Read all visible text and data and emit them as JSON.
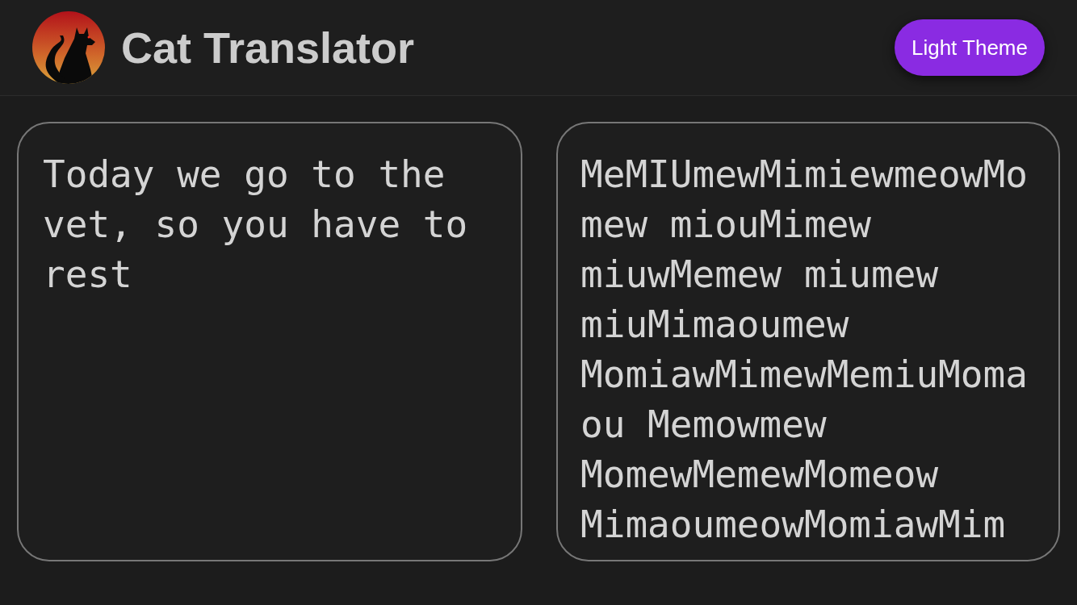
{
  "header": {
    "title": "Cat Translator",
    "theme_button": "Light Theme"
  },
  "input": {
    "value": "Today we go to the vet, so you have to rest"
  },
  "output": {
    "text": "MeMIUmewMimiewmeowMomew miouMimew miuwMemew miumew miuMimaoumew MomiawMimewMemiuMomaou Memowmew MomewMemewMomeow MimaoumeowMomiawMim"
  }
}
